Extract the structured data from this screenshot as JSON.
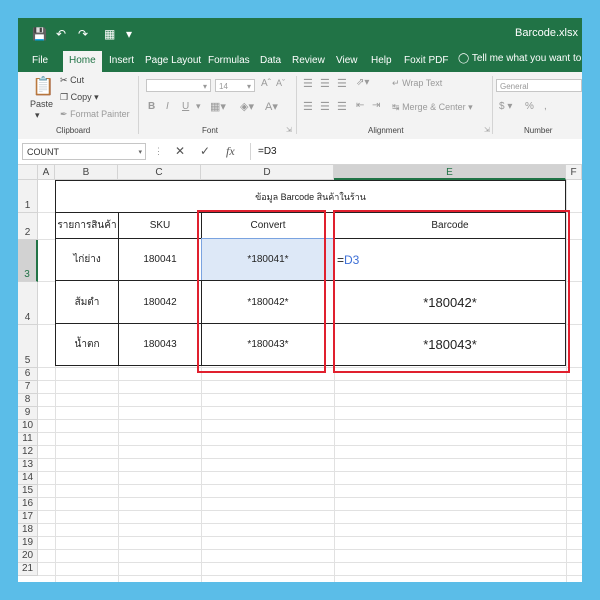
{
  "title_bar": {
    "quick_access_icons": [
      "save-icon",
      "undo-icon",
      "redo-icon",
      "table-icon",
      "customize-icon"
    ],
    "filename": "Barcode.xlsx"
  },
  "tabs": [
    "File",
    "Home",
    "Insert",
    "Page Layout",
    "Formulas",
    "Data",
    "Review",
    "View",
    "Help",
    "Foxit PDF"
  ],
  "active_tab": "Home",
  "tell_me": "Tell me what you want to do",
  "ribbon": {
    "clipboard": {
      "paste": "Paste",
      "cut": "Cut",
      "copy": "Copy",
      "format_painter": "Format Painter",
      "label": "Clipboard"
    },
    "font": {
      "size": "14",
      "bold": "B",
      "italic": "I",
      "underline": "U",
      "label": "Font"
    },
    "alignment": {
      "wrap_text": "Wrap Text",
      "merge_center": "Merge & Center",
      "label": "Alignment"
    },
    "number": {
      "format": "General",
      "currency": "$",
      "percent": "%",
      "comma": ",",
      "label": "Number"
    }
  },
  "formula_bar": {
    "name_box": "COUNT",
    "cancel": "✕",
    "enter": "✓",
    "fx": "fx",
    "formula": "=D3"
  },
  "columns": [
    "A",
    "B",
    "C",
    "D",
    "E",
    "F"
  ],
  "rows": [
    "1",
    "2",
    "3",
    "4",
    "5",
    "6",
    "7",
    "8",
    "9",
    "10",
    "11",
    "12",
    "13",
    "14",
    "15",
    "16",
    "17",
    "18",
    "19",
    "20",
    "21"
  ],
  "sheet": {
    "title": "ข้อมูล Barcode สินค้าในร้าน",
    "headers": {
      "product": "รายการสินค้า",
      "sku": "SKU",
      "convert": "Convert",
      "barcode": "Barcode"
    },
    "rows": [
      {
        "product": "ไก่ย่าง",
        "sku": "180041",
        "convert": "*180041*",
        "barcode_eq": "=",
        "barcode_ref": "D3"
      },
      {
        "product": "ส้มตำ",
        "sku": "180042",
        "convert": "*180042*",
        "barcode": "*180042*"
      },
      {
        "product": "น้ำตก",
        "sku": "180043",
        "convert": "*180043*",
        "barcode": "*180043*"
      }
    ]
  },
  "colors": {
    "excel_green": "#217346",
    "highlight_red": "#e0202e",
    "selected_cell": "#dde8f7",
    "formula_ref": "#3d6fd6",
    "background": "#5bbde8"
  }
}
